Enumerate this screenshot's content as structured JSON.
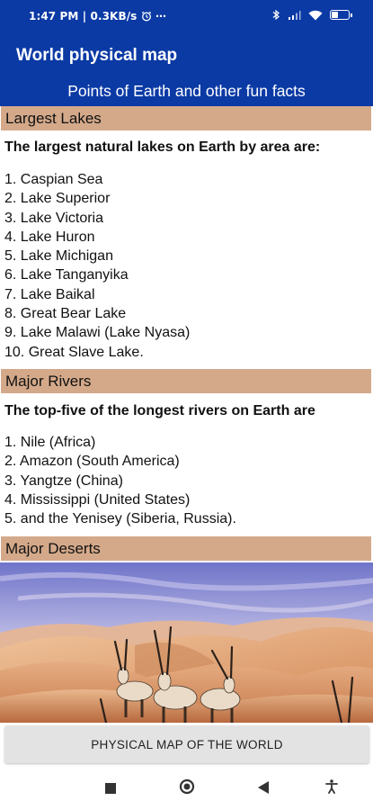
{
  "status": {
    "time_speed": "1:47 PM | 0.3KB/s",
    "more": "⋯",
    "battery_label": "9"
  },
  "appbar": {
    "title": "World physical map",
    "subtitle": "Points of Earth and other fun facts"
  },
  "lakes": {
    "header": "Largest Lakes",
    "intro": "The largest natural lakes on Earth by area are:",
    "items": [
      "1. Caspian Sea",
      " 2. Lake Superior",
      " 3. Lake Victoria",
      " 4. Lake Huron",
      " 5. Lake Michigan",
      " 6. Lake Tanganyika",
      " 7. Lake Baikal",
      " 8. Great Bear Lake",
      " 9. Lake Malawi (Lake Nyasa)",
      " 10. Great Slave Lake."
    ]
  },
  "rivers": {
    "header": "Major Rivers",
    "intro": "The top-five of the longest rivers on Earth are",
    "items": [
      "1. Nile (Africa)",
      " 2. Amazon (South America)",
      " 3. Yangtze (China)",
      " 4. Mississippi (United States)",
      " 5. and the Yenisey (Siberia, Russia)."
    ]
  },
  "deserts": {
    "header": "Major Deserts"
  },
  "button": {
    "label": "PHYSICAL MAP OF THE WORLD"
  },
  "colors": {
    "appbar": "#0b3aa5",
    "section_header": "#d4a98a",
    "button": "#e3e3e3"
  }
}
